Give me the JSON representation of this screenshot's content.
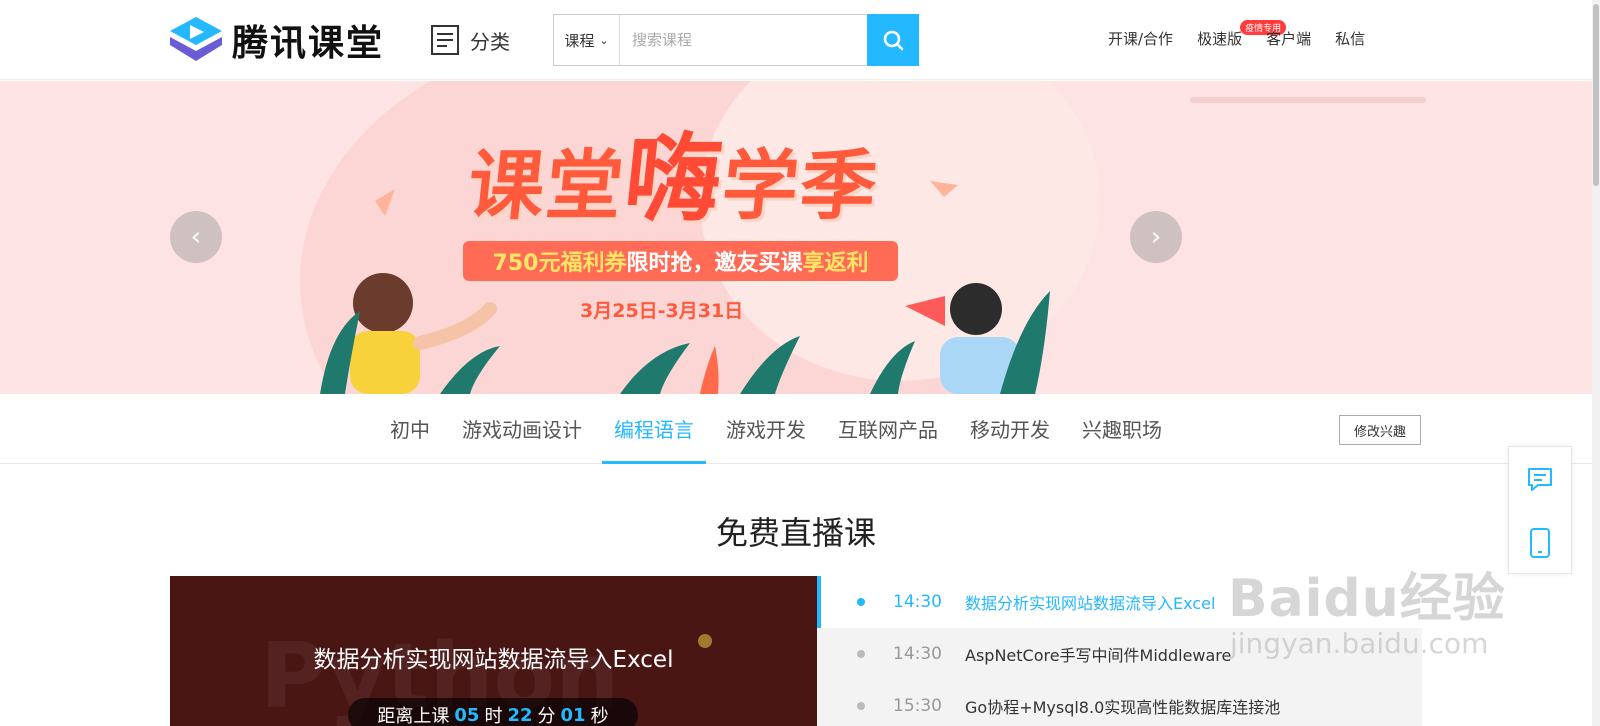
{
  "header": {
    "logo_text": "腾讯课堂",
    "category_label": "分类",
    "search": {
      "scope": "课程",
      "placeholder": "搜索课程"
    },
    "links": [
      {
        "label": "开课/合作"
      },
      {
        "label": "极速版",
        "badge": "疫情专用"
      },
      {
        "label": "客户端"
      },
      {
        "label": "私信"
      }
    ]
  },
  "banner": {
    "title_part1": "课堂",
    "title_part2": "嗨",
    "title_part3": "学季",
    "promo_highlight": "750元福利券",
    "promo_middle": "限时抢，邀友买课",
    "promo_end": "享返利",
    "date": "3月25日-3月31日",
    "prev_glyph": "‹",
    "next_glyph": "›"
  },
  "tabs": {
    "items": [
      {
        "label": "初中"
      },
      {
        "label": "游戏动画设计"
      },
      {
        "label": "编程语言",
        "active": true
      },
      {
        "label": "游戏开发"
      },
      {
        "label": "互联网产品"
      },
      {
        "label": "移动开发"
      },
      {
        "label": "兴趣职场"
      }
    ],
    "edit_label": "修改兴趣"
  },
  "section": {
    "title": "免费直播课"
  },
  "live": {
    "bg_word": "Python",
    "title": "数据分析实现网站数据流导入Excel",
    "countdown": {
      "prefix": "距离上课",
      "hours": "05",
      "hours_unit": "时",
      "minutes": "22",
      "minutes_unit": "分",
      "seconds": "01",
      "seconds_unit": "秒"
    }
  },
  "schedule": [
    {
      "time": "14:30",
      "name": "数据分析实现网站数据流导入Excel",
      "active": true
    },
    {
      "time": "14:30",
      "name": "AspNetCore手写中间件Middleware",
      "active": false
    },
    {
      "time": "15:30",
      "name": "Go协程+Mysql8.0实现高性能数据库连接池",
      "active": false
    }
  ],
  "watermark": {
    "line1": "Baidu经验",
    "line2": "jingyan.baidu.com"
  },
  "colors": {
    "accent": "#23b8ff",
    "banner_bg": "#fde3e3",
    "promo_red": "#ff5a3c"
  },
  "icons": {
    "logo": "tencent-classroom-play-icon",
    "category": "list-icon",
    "search": "search-icon",
    "side_top": "chat-icon",
    "side_bottom": "mobile-icon"
  }
}
